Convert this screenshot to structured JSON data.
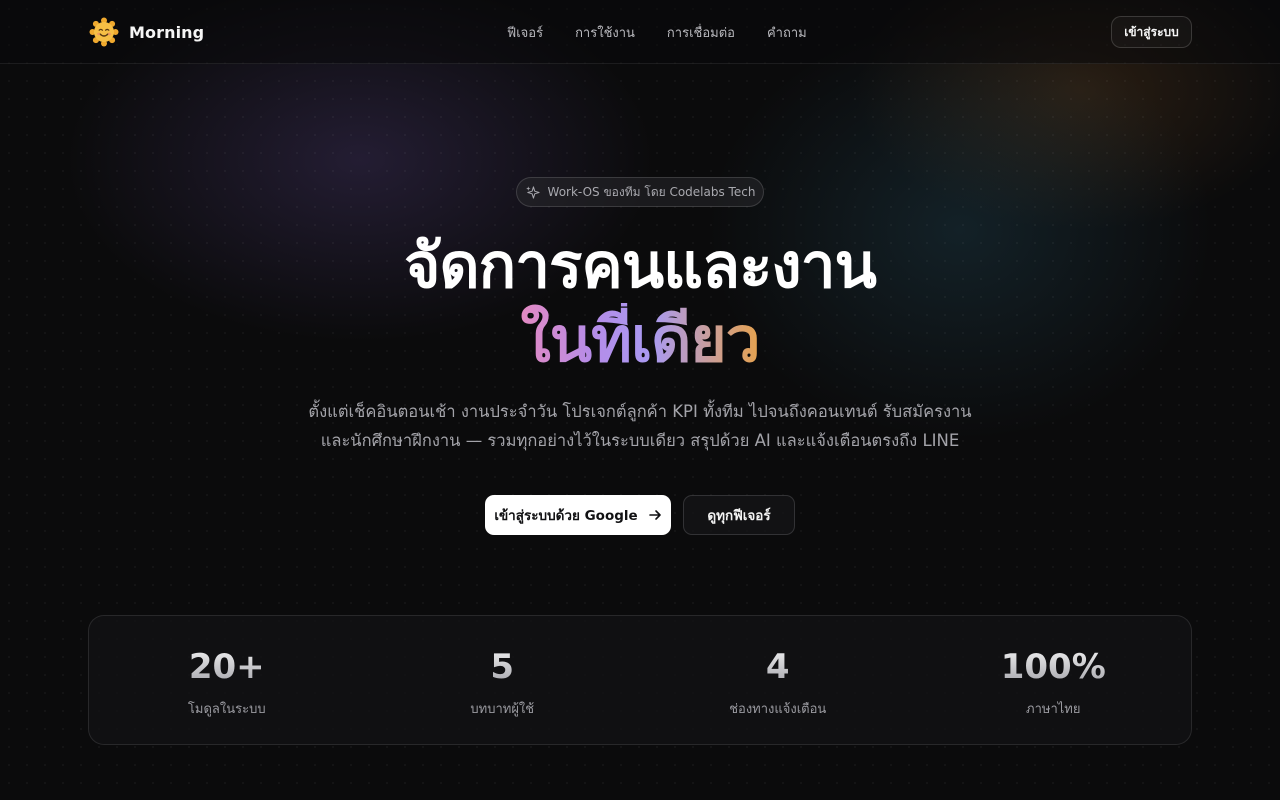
{
  "brand": {
    "name": "Morning",
    "logo_icon": "sun-face-icon",
    "logo_color": "#f5b73b"
  },
  "nav": {
    "items": [
      "ฟีเจอร์",
      "การใช้งาน",
      "การเชื่อมต่อ",
      "คำถาม"
    ],
    "login_label": "เข้าสู่ระบบ"
  },
  "hero": {
    "badge_icon": "sparkle-icon",
    "badge_text": "Work-OS ของทีม โดย Codelabs Tech",
    "title_line1": "จัดการคนและงาน",
    "title_line2": "ในที่เดียว",
    "subtitle_line1": "ตั้งแต่เช็คอินตอนเช้า งานประจำวัน โปรเจกต์ลูกค้า KPI ทั้งทีม ไปจนถึงคอนเทนต์ รับสมัครงาน",
    "subtitle_line2": "และนักศึกษาฝึกงาน — รวมทุกอย่างไว้ในระบบเดียว สรุปด้วย AI และแจ้งเตือนตรงถึง LINE",
    "primary_cta": "เข้าสู่ระบบด้วย Google",
    "primary_cta_icon": "arrow-right-icon",
    "secondary_cta": "ดูทุกฟีเจอร์"
  },
  "stats": [
    {
      "value": "20+",
      "label": "โมดูลในระบบ"
    },
    {
      "value": "5",
      "label": "บทบาทผู้ใช้"
    },
    {
      "value": "4",
      "label": "ช่องทางแจ้งเตือน"
    },
    {
      "value": "100%",
      "label": "ภาษาไทย"
    }
  ],
  "colors": {
    "background": "#0b0b0c",
    "gradient_pink": "#e48ac2",
    "gradient_purple": "#a99af2",
    "gradient_orange": "#e6a24e",
    "primary_button_bg": "#ffffff"
  }
}
